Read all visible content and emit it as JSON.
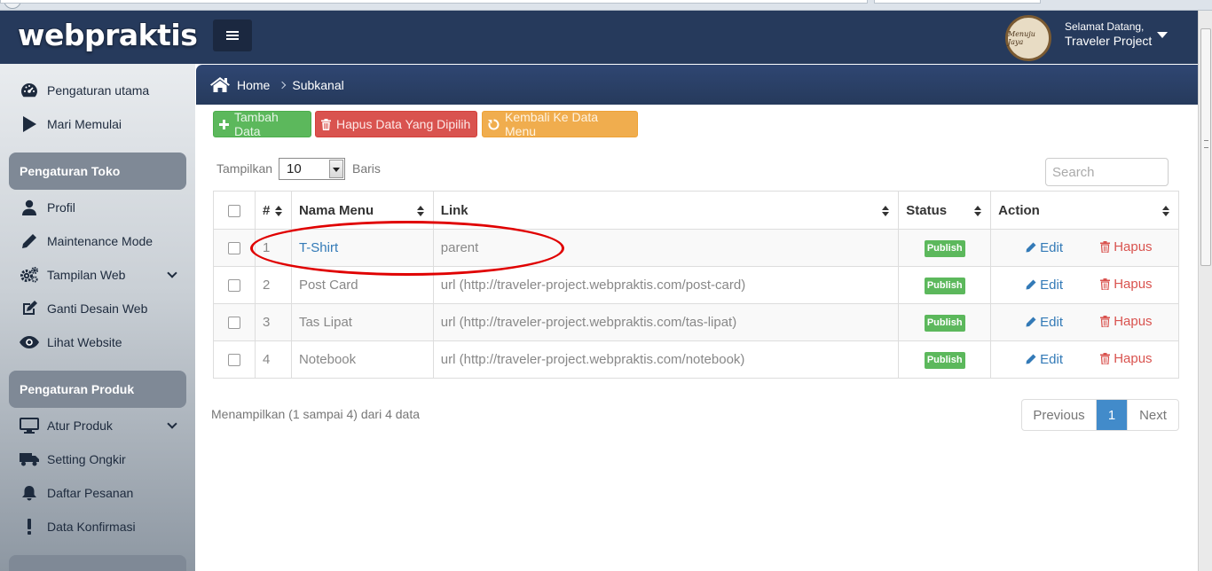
{
  "header": {
    "logo": "webpraktis",
    "avatar_text": "Menuju Jaya",
    "welcome_line": "Selamat Datang,",
    "user_name": "Traveler Project"
  },
  "sidebar": {
    "items_top": [
      {
        "label": "Pengaturan utama",
        "icon": "dashboard-icon"
      },
      {
        "label": "Mari Memulai",
        "icon": "play-icon"
      }
    ],
    "section_toko": "Pengaturan Toko",
    "items_toko": [
      {
        "label": "Profil",
        "icon": "user-icon"
      },
      {
        "label": "Maintenance Mode",
        "icon": "pencil-icon"
      },
      {
        "label": "Tampilan Web",
        "icon": "cogs-icon"
      },
      {
        "label": "Ganti Desain Web",
        "icon": "edit-icon"
      },
      {
        "label": "Lihat Website",
        "icon": "eye-icon"
      }
    ],
    "section_produk": "Pengaturan Produk",
    "items_produk": [
      {
        "label": "Atur Produk",
        "icon": "desktop-icon"
      },
      {
        "label": "Setting Ongkir",
        "icon": "truck-icon"
      },
      {
        "label": "Daftar Pesanan",
        "icon": "bell-icon"
      },
      {
        "label": "Data Konfirmasi",
        "icon": "exclamation-icon"
      }
    ]
  },
  "breadcrumb": {
    "home": "Home",
    "current": "Subkanal"
  },
  "actions": {
    "add": "Tambah Data",
    "delete_selected": "Hapus Data Yang Dipilih",
    "back": "Kembali Ke Data Menu"
  },
  "table_controls": {
    "show_label": "Tampilkan",
    "page_length": "10",
    "rows_label": "Baris",
    "search_placeholder": "Search"
  },
  "table": {
    "headers": {
      "no": "#",
      "name": "Nama Menu",
      "link": "Link",
      "status": "Status",
      "action": "Action"
    },
    "rows": [
      {
        "no": "1",
        "name": "T-Shirt",
        "link": "parent",
        "status": "Publish",
        "edit": "Edit",
        "delete": "Hapus"
      },
      {
        "no": "2",
        "name": "Post Card",
        "link": "url (http://traveler-project.webpraktis.com/post-card)",
        "status": "Publish",
        "edit": "Edit",
        "delete": "Hapus"
      },
      {
        "no": "3",
        "name": "Tas Lipat",
        "link": "url (http://traveler-project.webpraktis.com/tas-lipat)",
        "status": "Publish",
        "edit": "Edit",
        "delete": "Hapus"
      },
      {
        "no": "4",
        "name": "Notebook",
        "link": "url (http://traveler-project.webpraktis.com/notebook)",
        "status": "Publish",
        "edit": "Edit",
        "delete": "Hapus"
      }
    ]
  },
  "footer": {
    "info": "Menampilkan (1 sampai 4) dari 4 data",
    "prev": "Previous",
    "current_page": "1",
    "next": "Next"
  },
  "colors": {
    "header_bg": "#263a5c",
    "publish_badge": "#5cb85c",
    "link_blue": "#337ab7",
    "delete_red": "#d9534f",
    "highlight_red": "#e00000"
  }
}
